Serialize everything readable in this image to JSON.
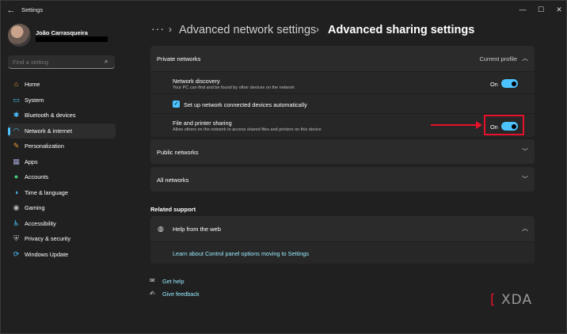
{
  "window": {
    "title": "Settings",
    "controls": {
      "minimize": "—",
      "maximize": "☐",
      "close": "✕"
    }
  },
  "user": {
    "name": "João Carrasqueira"
  },
  "search": {
    "placeholder": "Find a setting"
  },
  "sidebar": {
    "items": [
      {
        "label": "Home",
        "icon": "home-icon",
        "glyph": "⌂",
        "color": "#f0a030"
      },
      {
        "label": "System",
        "icon": "monitor-icon",
        "glyph": "▭",
        "color": "#4cc2ff"
      },
      {
        "label": "Bluetooth & devices",
        "icon": "bluetooth-icon",
        "glyph": "✱",
        "color": "#4cc2ff"
      },
      {
        "label": "Network & internet",
        "icon": "wifi-icon",
        "glyph": "◠",
        "color": "#4cc2ff"
      },
      {
        "label": "Personalization",
        "icon": "brush-icon",
        "glyph": "✎",
        "color": "#f0a030"
      },
      {
        "label": "Apps",
        "icon": "apps-icon",
        "glyph": "▦",
        "color": "#a0a0d0"
      },
      {
        "label": "Accounts",
        "icon": "person-icon",
        "glyph": "●",
        "color": "#4cd080"
      },
      {
        "label": "Time & language",
        "icon": "globe-clock-icon",
        "glyph": "◑",
        "color": "#4cc2ff"
      },
      {
        "label": "Gaming",
        "icon": "gamepad-icon",
        "glyph": "◉",
        "color": "#c0c0c0"
      },
      {
        "label": "Accessibility",
        "icon": "accessibility-icon",
        "glyph": "♿",
        "color": "#4cc2ff"
      },
      {
        "label": "Privacy & security",
        "icon": "shield-icon",
        "glyph": "⛨",
        "color": "#c0c0c0"
      },
      {
        "label": "Windows Update",
        "icon": "update-icon",
        "glyph": "⟳",
        "color": "#4cc2ff"
      }
    ],
    "active_index": 3
  },
  "breadcrumb": {
    "overflow": "···",
    "separator": "›",
    "parent": "Advanced network settings",
    "current": "Advanced sharing settings"
  },
  "private_networks": {
    "title": "Private networks",
    "status": "Current profile",
    "network_discovery": {
      "title": "Network discovery",
      "description": "Your PC can find and be found by other devices on the network",
      "state": "On"
    },
    "auto_setup": {
      "label": "Set up network connected devices automatically",
      "checked": true,
      "check_glyph": "✓"
    },
    "file_sharing": {
      "title": "File and printer sharing",
      "description": "Allow others on the network to access shared files and printers on this device",
      "state": "On"
    }
  },
  "public_networks": {
    "title": "Public networks"
  },
  "all_networks": {
    "title": "All networks"
  },
  "related_support": {
    "heading": "Related support",
    "help_from_web": "Help from the web",
    "link": "Learn about Control panel options moving to Settings"
  },
  "footer": {
    "get_help": "Get help",
    "give_feedback": "Give feedback"
  },
  "watermark": {
    "bracket": "[",
    "text": "XDA"
  },
  "colors": {
    "accent": "#4cc2ff",
    "annotation": "#e8102a",
    "link": "#99ebff"
  }
}
